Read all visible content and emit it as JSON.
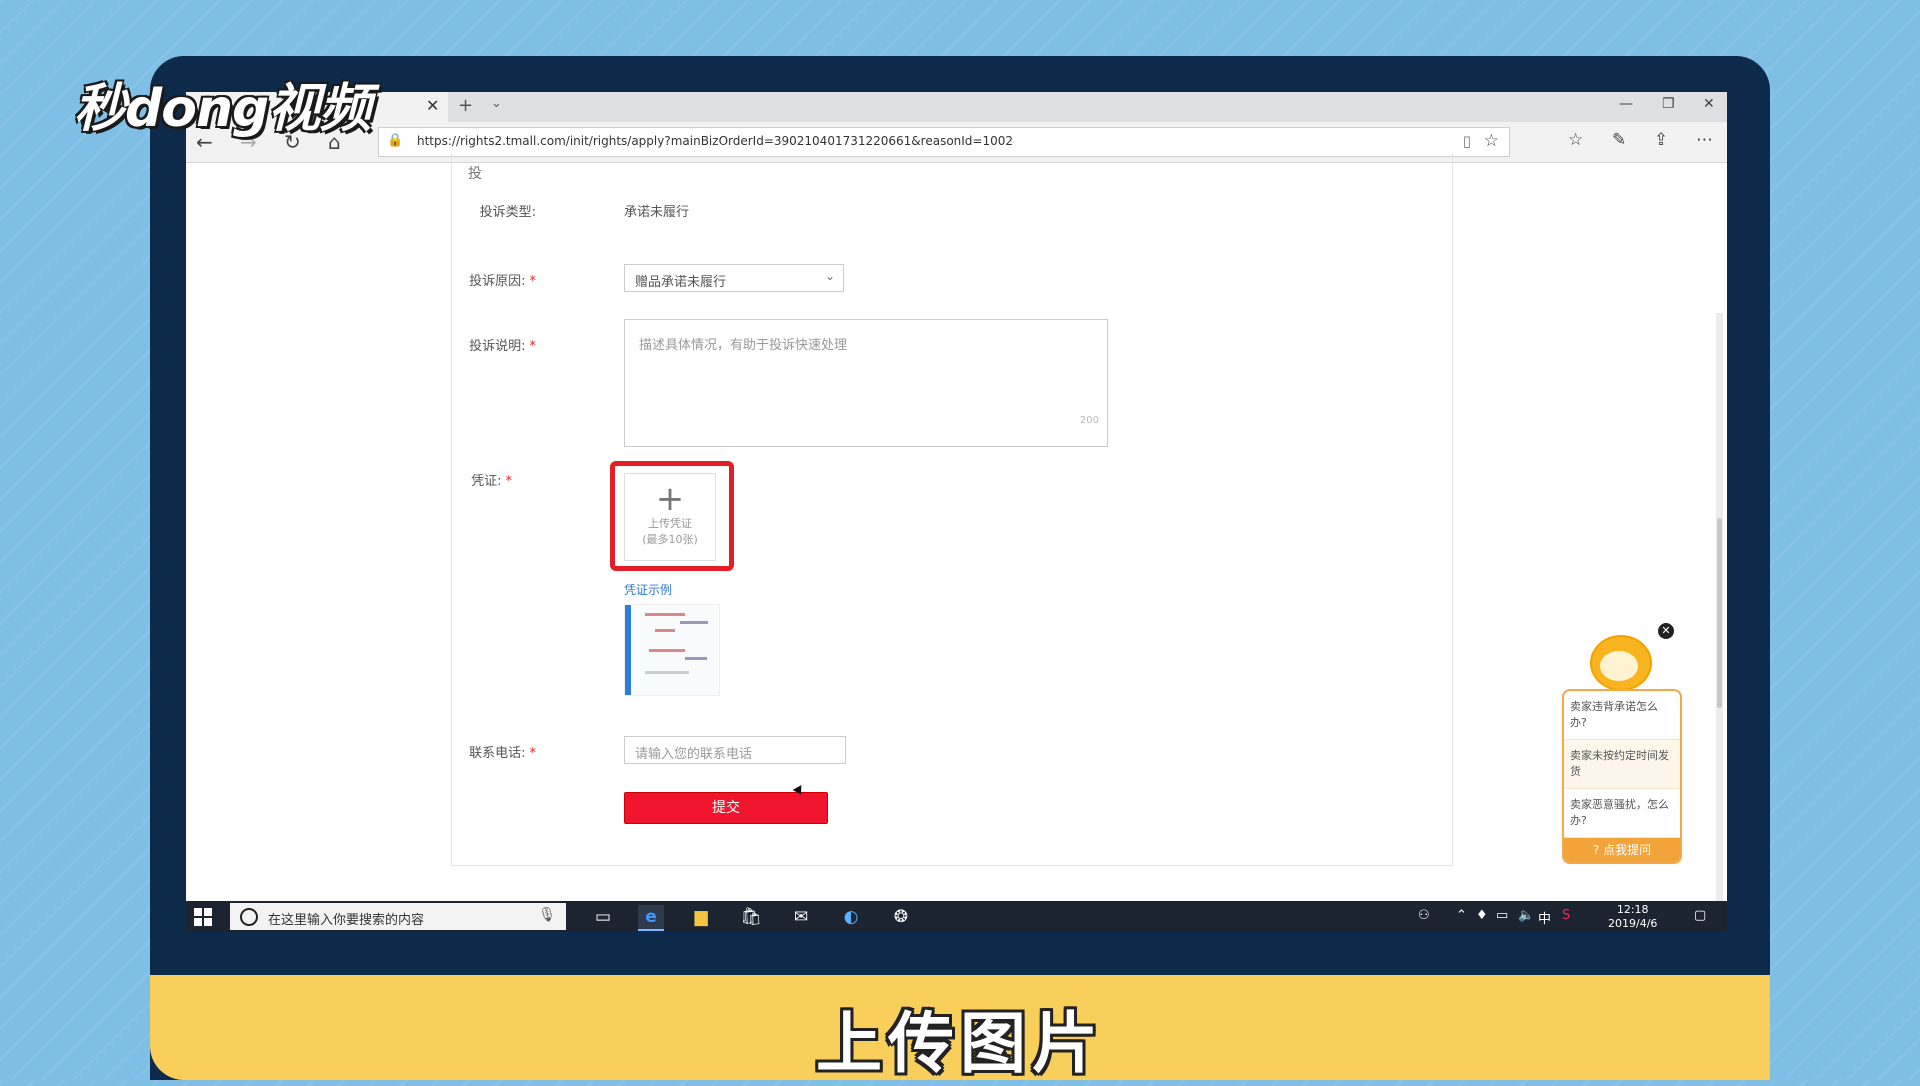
{
  "logo_text": "秒dong视频",
  "caption": "上传图片",
  "browser": {
    "url": "https://rights2.tmall.com/init/rights/apply?mainBizOrderId=390210401731220661&reasonId=1002",
    "tab_close": "✕",
    "new_tab": "+",
    "tab_menu": "⌄"
  },
  "form": {
    "header_fragment": "投",
    "type_label": "投诉类型:",
    "type_value": "承诺未履行",
    "reason_label": "投诉原因:",
    "reason_value": "赠品承诺未履行",
    "desc_label": "投诉说明:",
    "desc_placeholder": "描述具体情况，有助于投诉快速处理",
    "desc_counter": "200",
    "evidence_label": "凭证:",
    "required_mark": "*",
    "upload_plus": "+",
    "upload_label_1": "上传凭证",
    "upload_label_2": "(最多10张)",
    "example_link": "凭证示例",
    "phone_label": "联系电话:",
    "phone_placeholder": "请输入您的联系电话",
    "submit": "提交"
  },
  "assistant": {
    "close": "✕",
    "questions": [
      "卖家违背承诺怎么办?",
      "卖家未按约定时间发货",
      "卖家恶意骚扰，怎么办?"
    ],
    "ask_button": "点我提问"
  },
  "taskbar": {
    "search_placeholder": "在这里输入你要搜索的内容",
    "ime": "中",
    "time": "12:18",
    "date": "2019/4/6"
  }
}
